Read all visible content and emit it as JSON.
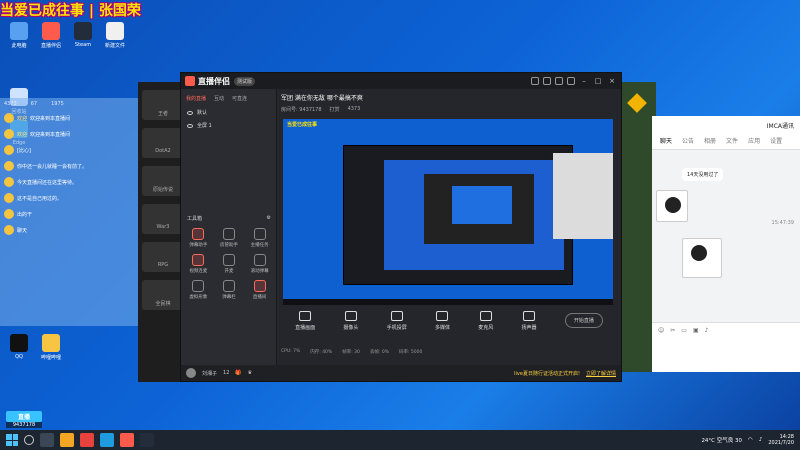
{
  "overlay_text": "当爱已成往事 | 张国荣",
  "desktop_icons": [
    {
      "label": "此电脑",
      "color": "#5aa0f0"
    },
    {
      "label": "直播伴侣",
      "color": "#ff5b4d"
    },
    {
      "label": "Steam",
      "color": "#222c3a"
    },
    {
      "label": "新建文件",
      "color": "#f0f0f0"
    },
    {
      "label": "回收站",
      "color": "#cfe3ff"
    },
    {
      "label": "Edge",
      "color": "#1f9ce0"
    },
    {
      "label": "QQ",
      "color": "#111111"
    },
    {
      "label": "哔哩哔哩",
      "color": "#f7c443"
    }
  ],
  "chat": {
    "header": [
      "4373",
      "67",
      "1975"
    ],
    "lines": [
      {
        "tag": "欢迎",
        "text": "欢迎来到本直播间"
      },
      {
        "tag": "欢迎",
        "text": "欢迎来到本直播间"
      },
      {
        "tag": "",
        "text": "[比心]"
      },
      {
        "tag": "",
        "text": "你中还一会儿就睡一会有前了。"
      },
      {
        "tag": "",
        "text": "今天直播间还在这里等待。"
      },
      {
        "tag": "",
        "text": "这不是自己用过的。"
      },
      {
        "tag": "",
        "text": "出的干"
      },
      {
        "tag": "",
        "text": "聊天"
      }
    ]
  },
  "bg_left_items": [
    "王者",
    "DotA2",
    "原始传说",
    "War3",
    "RPG",
    "全民棋"
  ],
  "app": {
    "name": "直播伴侣",
    "version": "测试版",
    "side_tabs": [
      "我的直播",
      "互动",
      "可直连"
    ],
    "scenes": [
      "默认",
      "全屏 1"
    ],
    "toolbox_title": "工具箱",
    "tools": [
      {
        "label": "弹幕助手",
        "hot": true
      },
      {
        "label": "房管助手",
        "hot": false
      },
      {
        "label": "主播任务",
        "hot": false
      },
      {
        "label": "视频连麦",
        "hot": true
      },
      {
        "label": "开麦",
        "hot": false
      },
      {
        "label": "滚动弹幕",
        "hot": false
      },
      {
        "label": "虚拟形象",
        "hot": false
      },
      {
        "label": "弹幕栏",
        "hot": false
      },
      {
        "label": "直播间",
        "hot": true
      }
    ],
    "live_title": "军团 满在你无敌 哪个最搞不爽",
    "live_meta": [
      "房间号: 9437178",
      "打赏",
      "4373"
    ],
    "preview_label": "当爱已成往事",
    "controls": [
      "直播画面",
      "摄像头",
      "手机投屏",
      "多媒体",
      "麦克风",
      "扬声器"
    ],
    "start_button": "开始直播",
    "perf": [
      "CPU: 7%",
      "内存: 40%",
      "帧率: 30",
      "丢帧: 0%",
      "码率: 5000"
    ],
    "footer": {
      "user": "刘湘子",
      "fans": "12",
      "notice": "live夏日随行证活动正式开启!",
      "notice_link": "立即了解详情"
    }
  },
  "qq_window": {
    "title": "IMCA通讯",
    "tabs": [
      "聊天",
      "公告",
      "相册",
      "文件",
      "应用",
      "设置"
    ],
    "bubble_1": "14天没用过了",
    "time": "15:47:39"
  },
  "watermark": {
    "brand": "直播",
    "id": "9437178"
  },
  "taskbar": {
    "weather": "24°C 空气良 30",
    "time": "14:28",
    "date": "2021/7/20"
  }
}
